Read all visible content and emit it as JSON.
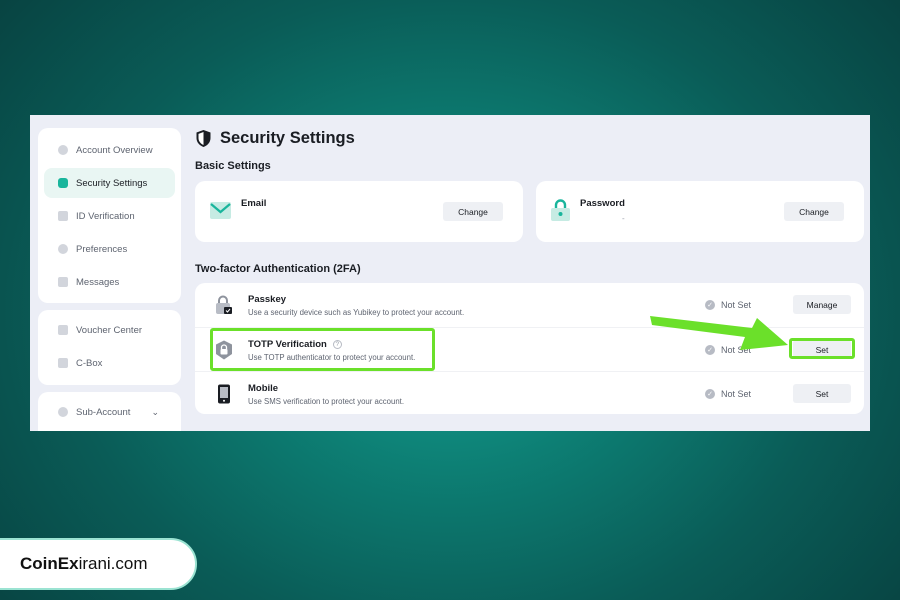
{
  "page": {
    "title": "Security Settings"
  },
  "sidebar": {
    "group1": [
      {
        "label": "Account Overview",
        "icon": "pie-chart-icon"
      },
      {
        "label": "Security Settings",
        "icon": "shield-icon",
        "active": true
      },
      {
        "label": "ID Verification",
        "icon": "id-card-icon"
      },
      {
        "label": "Preferences",
        "icon": "sliders-icon"
      },
      {
        "label": "Messages",
        "icon": "message-icon"
      }
    ],
    "group2": [
      {
        "label": "Voucher Center",
        "icon": "voucher-icon"
      },
      {
        "label": "C-Box",
        "icon": "gift-box-icon"
      }
    ],
    "group3": [
      {
        "label": "Sub-Account",
        "icon": "cloud-icon",
        "expandable": true
      }
    ]
  },
  "basic": {
    "heading": "Basic Settings",
    "email": {
      "label": "Email",
      "button": "Change"
    },
    "password": {
      "label": "Password",
      "value": "-",
      "button": "Change"
    }
  },
  "twofa": {
    "heading": "Two-factor Authentication (2FA)",
    "rows": [
      {
        "title": "Passkey",
        "desc": "Use a security device such as Yubikey to protect your account.",
        "status": "Not Set",
        "button": "Manage",
        "icon": "passkey-lock-icon"
      },
      {
        "title": "TOTP Verification",
        "desc": "Use TOTP authenticator to protect your account.",
        "status": "Not Set",
        "button": "Set",
        "icon": "totp-shield-lock-icon",
        "help": "?"
      },
      {
        "title": "Mobile",
        "desc": "Use SMS verification to protect your account.",
        "status": "Not Set",
        "button": "Set",
        "icon": "mobile-phone-icon"
      }
    ]
  },
  "annotation": {
    "highlight_color": "#6be02a"
  },
  "brand": {
    "name_bold": "CoinEx",
    "name_rest": "irani.com"
  }
}
